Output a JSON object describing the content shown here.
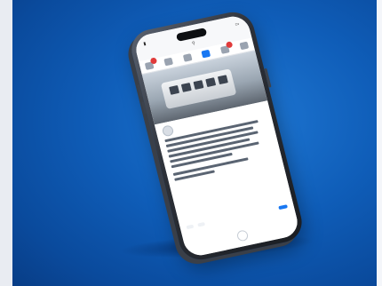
{
  "colors": {
    "background": "#0f5db8",
    "accent": "#1877f2",
    "badge": "#e03a3a"
  },
  "device": {
    "type": "smartphone",
    "screen": {
      "nav_icons": [
        "home-icon",
        "friends-icon",
        "video-icon",
        "marketplace-icon",
        "notifications-icon",
        "menu-icon"
      ],
      "active_nav_index": 3,
      "photo": {
        "subject": "tram"
      }
    }
  }
}
